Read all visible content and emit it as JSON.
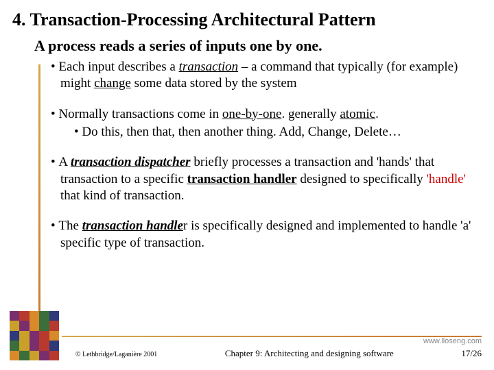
{
  "title": "4.  Transaction-Processing Architectural Pattern",
  "subtitle": "A process reads a series of inputs one by one.",
  "b1_a": "Each input describes a ",
  "b1_b": "transaction",
  "b1_c": " – a command that typically (for example) might ",
  "b1_d": "change",
  "b1_e": " some data stored by the system",
  "b2_a": "Normally transactions come in ",
  "b2_b": "one-by-one",
  "b2_c": ".  generally ",
  "b2_d": "atomic",
  "b2_e": ".",
  "b2s": "Do this, then that, then another thing.  Add, Change, Delete…",
  "b3_a": "A ",
  "b3_b": "transaction dispatcher",
  "b3_c": " briefly processes a transaction and 'hands' that transaction to a specific ",
  "b3_d": "transaction handler",
  "b3_e": " designed to specifically ",
  "b3_f": "'handle'",
  "b3_g": " that kind of transaction.",
  "b4_a": "The ",
  "b4_b": "transaction handle",
  "b4_c": "r is specifically designed and implemented to handle 'a' specific type of transaction.",
  "url": "www.lloseng.com",
  "copy": "© Lethbridge/Laganière 2001",
  "chap": "Chapter 9: Architecting and designing software",
  "page": "17/26",
  "weave_colors": [
    "#7a2e6e",
    "#b83a2e",
    "#d88a2a",
    "#3a6e3a",
    "#2e3a7a",
    "#c9a02a",
    "#7a2e6e",
    "#d88a2a",
    "#3a6e3a",
    "#b83a2e",
    "#2e3a7a",
    "#c9a02a",
    "#7a2e6e",
    "#b83a2e",
    "#d88a2a",
    "#3a6e3a",
    "#c9a02a",
    "#7a2e6e",
    "#b83a2e",
    "#2e3a7a",
    "#d88a2a",
    "#3a6e3a",
    "#c9a02a",
    "#7a2e6e",
    "#b83a2e"
  ]
}
